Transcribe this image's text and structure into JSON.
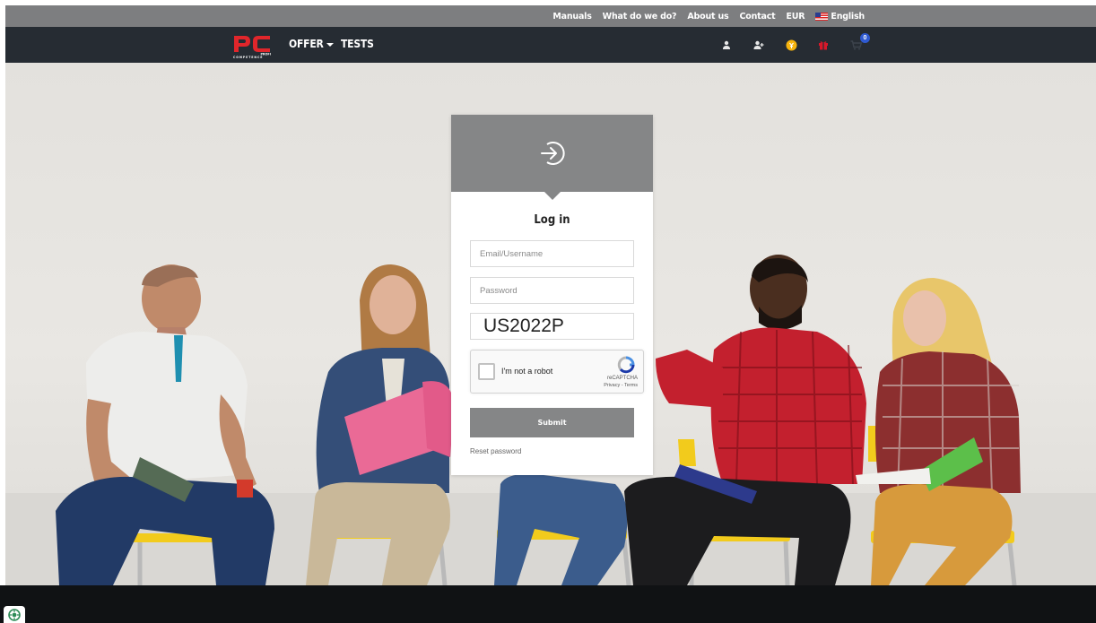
{
  "topbar": {
    "links": [
      "Manuals",
      "What do we do?",
      "About us",
      "Contact"
    ],
    "currency": "EUR",
    "language": "English"
  },
  "navbar": {
    "logo_text": "pc",
    "logo_subtitle": "PROFI COMPETENCE",
    "offer": "OFFER",
    "tests": "TESTS",
    "cart_count": "0"
  },
  "login": {
    "title": "Log in",
    "email_placeholder": "Email/Username",
    "password_placeholder": "Password",
    "code_value": "US2022P",
    "captcha_label": "I'm not a robot",
    "captcha_brand": "reCAPTCHA",
    "captcha_links": "Privacy - Terms",
    "submit_label": "Submit",
    "reset_label": "Reset password"
  },
  "colors": {
    "brand_red": "#e1262b",
    "nav_bg": "#262c33",
    "topbar_bg": "#7d7e80",
    "card_accent": "#858687",
    "coin": "#f6b40e",
    "gift": "#d8182a"
  }
}
